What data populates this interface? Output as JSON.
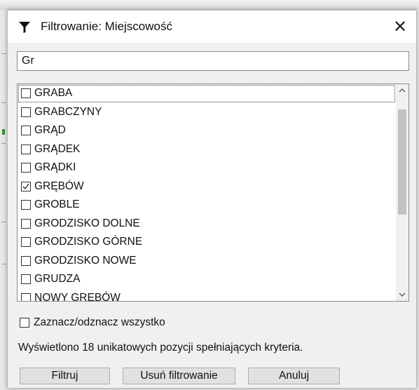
{
  "dialog": {
    "title": "Filtrowanie: Miejscowość",
    "close_symbol": "✕"
  },
  "search": {
    "value": "Gr"
  },
  "list": {
    "items": [
      {
        "label": "GRABA",
        "checked": false
      },
      {
        "label": "GRABCZYNY",
        "checked": false
      },
      {
        "label": "GRĄD",
        "checked": false
      },
      {
        "label": "GRĄDEK",
        "checked": false
      },
      {
        "label": "GRĄDKI",
        "checked": false
      },
      {
        "label": "GRĘBÓW",
        "checked": true
      },
      {
        "label": "GROBLE",
        "checked": false
      },
      {
        "label": "GRODZISKO DOLNE",
        "checked": false
      },
      {
        "label": "GRODZISKO GÓRNE",
        "checked": false
      },
      {
        "label": "GRODZISKO NOWE",
        "checked": false
      },
      {
        "label": "GRUDZA",
        "checked": false
      },
      {
        "label": "NOWY GRĘBÓW",
        "checked": false
      }
    ]
  },
  "select_all": {
    "label": "Zaznacz/odznacz wszystko",
    "checked": false
  },
  "status": {
    "text": "Wyświetlono 18 unikatowych pozycji spełniających kryteria."
  },
  "buttons": {
    "filter_label": "Filtruj",
    "remove_label": "Usuń filtrowanie",
    "cancel_label": "Anuluj"
  },
  "icons": {
    "title_icon": "filter-icon",
    "close": "close-icon",
    "scroll_up": "chevron-up-icon",
    "scroll_down": "chevron-down-icon",
    "check": "checkmark-icon"
  }
}
